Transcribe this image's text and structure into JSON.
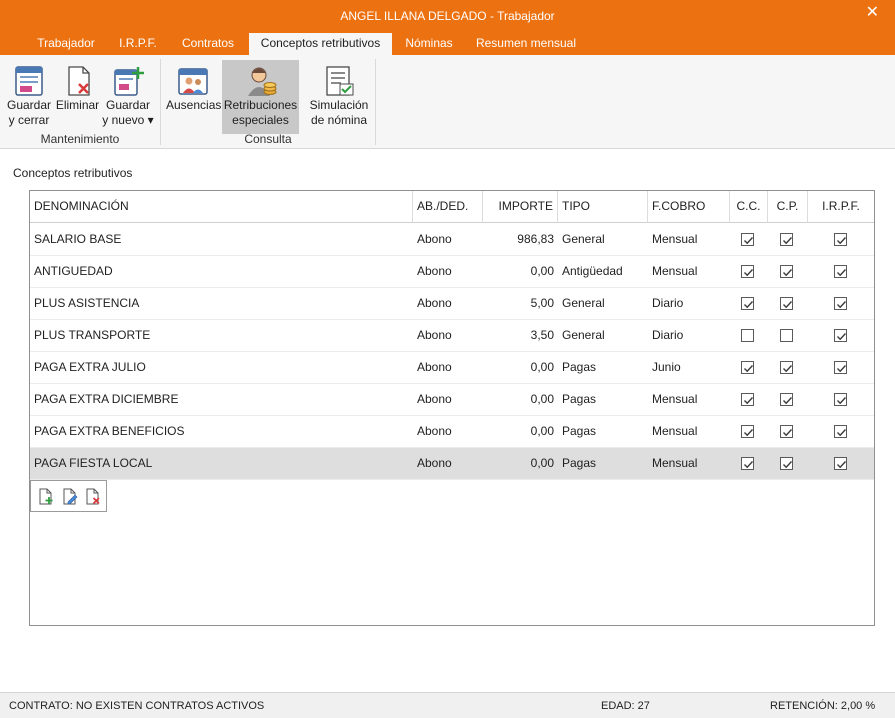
{
  "window": {
    "title": "ANGEL ILLANA DELGADO - Trabajador"
  },
  "tabs": [
    "Trabajador",
    "I.R.P.F.",
    "Contratos",
    "Conceptos retributivos",
    "Nóminas",
    "Resumen mensual"
  ],
  "active_tab": "Conceptos retributivos",
  "ribbon": {
    "buttons": [
      {
        "line1": "Guardar",
        "line2": "y cerrar",
        "icon": "save-close-icon"
      },
      {
        "line1": "Eliminar",
        "line2": "",
        "icon": "delete-icon"
      },
      {
        "line1": "Guardar",
        "line2": "y nuevo ▾",
        "icon": "save-new-icon"
      },
      {
        "line1": "Ausencias",
        "line2": "",
        "icon": "calendar-people-icon"
      },
      {
        "line1": "Retribuciones",
        "line2": "especiales",
        "icon": "person-coins-icon"
      },
      {
        "line1": "Simulación",
        "line2": "de nómina",
        "icon": "payroll-sim-icon"
      }
    ],
    "groups": [
      "Mantenimiento",
      "Consulta"
    ]
  },
  "section_title": "Conceptos retributivos",
  "table": {
    "headers": [
      "DENOMINACIÓN",
      "AB./DED.",
      "IMPORTE",
      "TIPO",
      "F.COBRO",
      "C.C.",
      "C.P.",
      "I.R.P.F."
    ],
    "rows": [
      {
        "denominacion": "SALARIO BASE",
        "abded": "Abono",
        "importe": "986,83",
        "tipo": "General",
        "fcobro": "Mensual",
        "cc": true,
        "cp": true,
        "irpf": true
      },
      {
        "denominacion": "ANTIGUEDAD",
        "abded": "Abono",
        "importe": "0,00",
        "tipo": "Antigüedad",
        "fcobro": "Mensual",
        "cc": true,
        "cp": true,
        "irpf": true
      },
      {
        "denominacion": "PLUS ASISTENCIA",
        "abded": "Abono",
        "importe": "5,00",
        "tipo": "General",
        "fcobro": "Diario",
        "cc": true,
        "cp": true,
        "irpf": true
      },
      {
        "denominacion": "PLUS TRANSPORTE",
        "abded": "Abono",
        "importe": "3,50",
        "tipo": "General",
        "fcobro": "Diario",
        "cc": false,
        "cp": false,
        "irpf": true
      },
      {
        "denominacion": "PAGA EXTRA JULIO",
        "abded": "Abono",
        "importe": "0,00",
        "tipo": "Pagas",
        "fcobro": "Junio",
        "cc": true,
        "cp": true,
        "irpf": true
      },
      {
        "denominacion": "PAGA EXTRA DICIEMBRE",
        "abded": "Abono",
        "importe": "0,00",
        "tipo": "Pagas",
        "fcobro": "Mensual",
        "cc": true,
        "cp": true,
        "irpf": true
      },
      {
        "denominacion": "PAGA EXTRA BENEFICIOS",
        "abded": "Abono",
        "importe": "0,00",
        "tipo": "Pagas",
        "fcobro": "Mensual",
        "cc": true,
        "cp": true,
        "irpf": true
      },
      {
        "denominacion": "PAGA FIESTA LOCAL",
        "abded": "Abono",
        "importe": "0,00",
        "tipo": "Pagas",
        "fcobro": "Mensual",
        "cc": true,
        "cp": true,
        "irpf": true
      }
    ],
    "selected_row": 7
  },
  "mini_toolbar": [
    "add-document-icon",
    "edit-document-icon",
    "delete-document-icon"
  ],
  "status": {
    "contrato": "CONTRATO: NO EXISTEN CONTRATOS ACTIVOS",
    "edad": "EDAD: 27",
    "retencion": "RETENCIÓN: 2,00 %"
  },
  "colors": {
    "accent": "#ec7211",
    "selected_row": "#dedede"
  }
}
